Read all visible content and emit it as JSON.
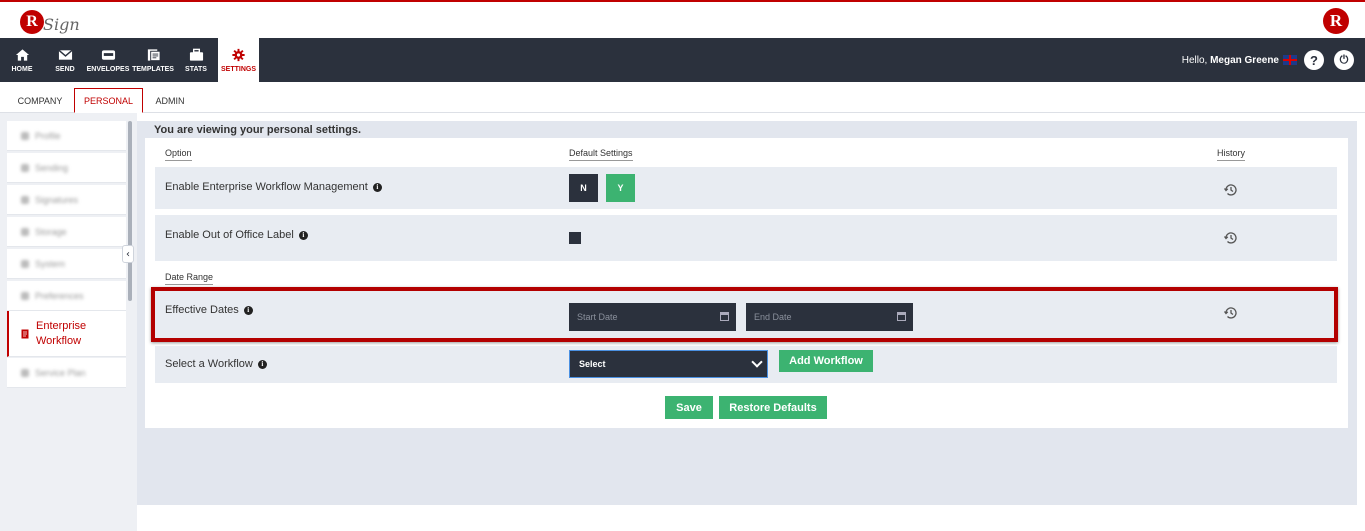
{
  "brand": {
    "logo_letter": "R",
    "logo_script": "Sign",
    "right_logo_letter": "R"
  },
  "nav": {
    "items": [
      {
        "label": "HOME",
        "icon": "home-icon"
      },
      {
        "label": "SEND",
        "icon": "envelope-icon"
      },
      {
        "label": "ENVELOPES",
        "icon": "inbox-icon"
      },
      {
        "label": "TEMPLATES",
        "icon": "template-icon"
      },
      {
        "label": "STATS",
        "icon": "briefcase-icon"
      },
      {
        "label": "SETTINGS",
        "icon": "gear-icon"
      }
    ],
    "greeting": "Hello,",
    "user_name": "Megan Greene",
    "help_label": "?",
    "power_label": "⏻"
  },
  "subtabs": [
    "COMPANY",
    "PERSONAL",
    "ADMIN"
  ],
  "sidebar": {
    "items": [
      {
        "label": "Profile"
      },
      {
        "label": "Sending"
      },
      {
        "label": "Signatures"
      },
      {
        "label": "Storage"
      },
      {
        "label": "System"
      },
      {
        "label": "Preferences"
      },
      {
        "label": "Enterprise Workflow"
      },
      {
        "label": "Service Plan"
      }
    ],
    "collapse_label": "‹"
  },
  "main": {
    "viewing_text": "You are viewing your personal settings.",
    "col_option": "Option",
    "col_default": "Default Settings",
    "col_history": "History",
    "row_enterprise": "Enable Enterprise Workflow Management",
    "toggle_n": "N",
    "toggle_y": "Y",
    "row_out_of_office": "Enable Out of Office Label",
    "date_range_label": "Date Range",
    "row_effective_dates": "Effective Dates",
    "start_date_placeholder": "Start Date",
    "end_date_placeholder": "End Date",
    "row_select_workflow": "Select a Workflow",
    "select_value": "Select",
    "add_workflow": "Add Workflow",
    "save": "Save",
    "restore_defaults": "Restore Defaults",
    "info_glyph": "i"
  },
  "colors": {
    "accent": "#c00000",
    "nav_bg": "#2b313d",
    "green": "#3cb371",
    "highlight": "#b30000"
  }
}
